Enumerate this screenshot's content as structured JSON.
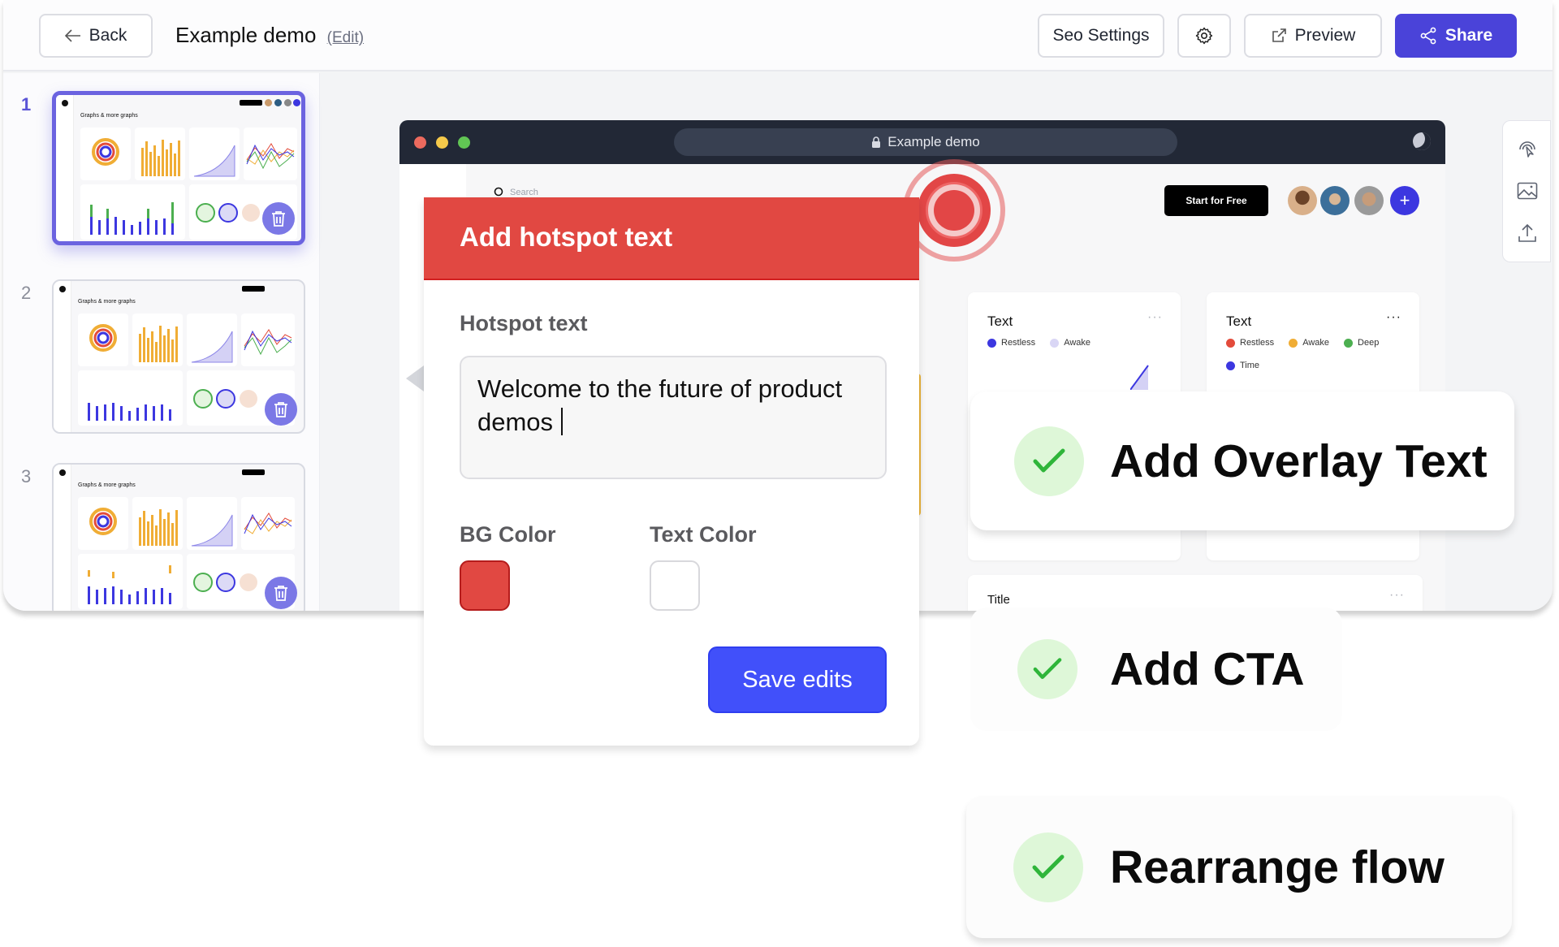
{
  "topbar": {
    "back_label": "Back",
    "title": "Example demo",
    "edit_label": "(Edit)",
    "seo_label": "Seo Settings",
    "preview_label": "Preview",
    "share_label": "Share",
    "icons": {
      "back": "arrow-left-icon",
      "settings": "gear-icon",
      "preview": "external-link-icon",
      "share": "share-icon"
    }
  },
  "slides": [
    {
      "number": "1",
      "title": "Graphs & more graphs",
      "active": true
    },
    {
      "number": "2",
      "title": "Graphs & more graphs",
      "active": false
    },
    {
      "number": "3",
      "title": "Graphs & more graphs",
      "active": false
    }
  ],
  "browser": {
    "url_label": "Example demo",
    "search_placeholder": "Search",
    "cta_label": "Start for Free",
    "plus_label": "+",
    "cards": [
      {
        "title": "Text",
        "legend": [
          "Restless",
          "Awake"
        ],
        "colors": [
          "#3c37e0",
          "#d9d6f5"
        ]
      },
      {
        "title": "Text",
        "legend": [
          "Restless",
          "Awake",
          "Deep",
          "Time"
        ],
        "colors": [
          "#e34b3b",
          "#f0ad35",
          "#4caf50",
          "#3c37e0"
        ]
      },
      {
        "title": "Title"
      }
    ],
    "more_label": "···"
  },
  "popup": {
    "title": "Add hotspot text",
    "text_label": "Hotspot text",
    "text_value": "Welcome to the future of product demos",
    "bg_color_label": "BG Color",
    "bg_color": "#e14842",
    "text_color_label": "Text Color",
    "text_color": "#ffffff",
    "save_label": "Save edits"
  },
  "tools": [
    "hotspot-pointer-icon",
    "image-icon",
    "upload-icon"
  ],
  "features": [
    {
      "label": "Add Overlay Text"
    },
    {
      "label": "Add CTA"
    },
    {
      "label": "Rearrange flow"
    }
  ],
  "colors": {
    "accent": "#4a43d9",
    "save": "#4150fa",
    "hotspot": "#e24646",
    "check": "#2fb53a"
  }
}
